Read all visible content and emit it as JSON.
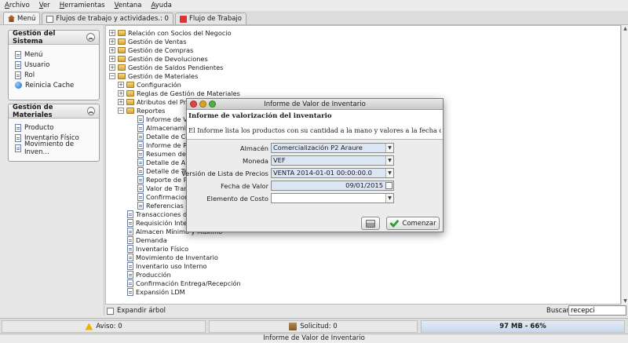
{
  "menubar": [
    "Archivo",
    "Ver",
    "Herramientas",
    "Ventana",
    "Ayuda"
  ],
  "tabs": [
    {
      "label": "Menú",
      "icon": "home-icon"
    },
    {
      "label": "Flujos de trabajo y actividades.: 0",
      "icon": "list-icon"
    },
    {
      "label": "Flujo de Trabajo",
      "icon": "workflow-icon"
    }
  ],
  "left": {
    "gestion_sistema": {
      "title": "Gestión del Sistema",
      "items": [
        "Menú",
        "Usuario",
        "Rol",
        "Reinicia Cache"
      ]
    },
    "gestion_materiales": {
      "title": "Gestión de Materiales",
      "items": [
        "Producto",
        "Inventario Físico",
        "Movimiento de Inven..."
      ]
    }
  },
  "tree": [
    {
      "label": "Relación con Socios del Negocio"
    },
    {
      "label": "Gestión de Ventas"
    },
    {
      "label": "Gestión de Compras"
    },
    {
      "label": "Gestión de Devoluciones"
    },
    {
      "label": "Gestión de Saldos Pendientes"
    },
    {
      "label": "Gestión de Materiales"
    },
    {
      "label": "Configuración"
    },
    {
      "label": "Reglas de Gestión de Materiales"
    },
    {
      "label": "Atributos del Pro"
    },
    {
      "label": "Reportes"
    },
    {
      "label": "Informe de V"
    },
    {
      "label": "Almacenami"
    },
    {
      "label": "Detalle de Co"
    },
    {
      "label": "Informe de Re"
    },
    {
      "label": "Resumen de"
    },
    {
      "label": "Detalle de Al"
    },
    {
      "label": "Detalle de Tra"
    },
    {
      "label": "Reporte de P"
    },
    {
      "label": "Valor de Tran"
    },
    {
      "label": "Confirmacione"
    },
    {
      "label": "Referencias d"
    },
    {
      "label": "Transacciones de"
    },
    {
      "label": "Requisición Intern"
    },
    {
      "label": "Almacen Mínimo y Máximo"
    },
    {
      "label": "Demanda"
    },
    {
      "label": "Inventario Físico"
    },
    {
      "label": "Movimiento de Inventario"
    },
    {
      "label": "Inventario uso Interno"
    },
    {
      "label": "Producción"
    },
    {
      "label": "Confirmación Entrega/Recepción"
    },
    {
      "label": "Expansión LDM"
    }
  ],
  "bottom": {
    "expand_label": "Expandir árbol",
    "search_label": "Buscar",
    "search_value": "recepci"
  },
  "status": {
    "aviso": "Aviso: 0",
    "solicitud": "Solicitud: 0",
    "memory": "97 MB - 66%",
    "window_title": "Informe de Valor de Inventario"
  },
  "dialog": {
    "title": "Informe de Valor de Inventario",
    "header": "Informe de valorización del inventario",
    "description": "El Informe lista los productos con su cantidad a la mano y valores a la fecha de valorización",
    "fields": {
      "almacen": {
        "label": "Almacén",
        "value": "Comercialización P2 Araure"
      },
      "moneda": {
        "label": "Moneda",
        "value": "VEF"
      },
      "version": {
        "label": "Versión de Lista de Precios",
        "value": "VENTA 2014-01-01 00:00:00.0"
      },
      "fecha": {
        "label": "Fecha de Valor",
        "value": "09/01/2015"
      },
      "elemento": {
        "label": "Elemento de Costo",
        "value": ""
      }
    },
    "start_button": "Comenzar"
  },
  "colors": {
    "light_close": "#e0443e",
    "light_min": "#dea123",
    "light_max": "#4db33d",
    "field_selected": "#dbe6f4"
  }
}
